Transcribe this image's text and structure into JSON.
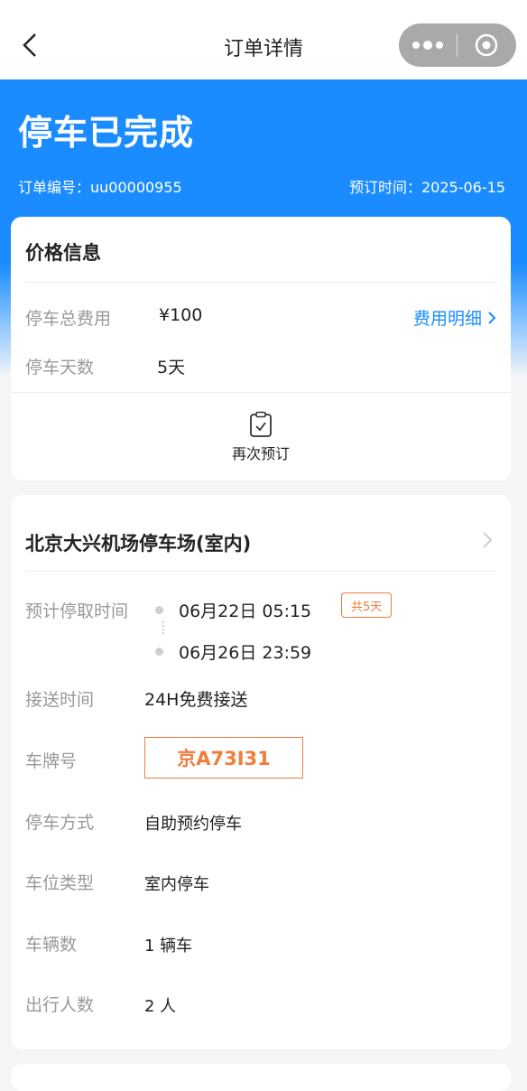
{
  "nav": {
    "title": "订单详情"
  },
  "status": {
    "title": "停车已完成",
    "order_no": "订单编号：uu00000955",
    "order_time": "预订时间：2025-06-15"
  },
  "price": {
    "title": "价格信息",
    "rows": [
      {
        "label": "停车总费用",
        "value": "¥100"
      },
      {
        "label": "停车天数",
        "value": "5天"
      }
    ],
    "detail_link": "费用明细",
    "rebook": "再次预订"
  },
  "lot": {
    "name": "北京大兴机场停车场(室内)",
    "time_label": "预计停取时间",
    "start_time": "06月22日 05:15",
    "end_time": "06月26日 23:59",
    "days_badge": "共5天",
    "shuttle_label": "接送时间",
    "shuttle_value": "24H免费接送",
    "plate_label": "车牌号",
    "plate_value": "京A73I31",
    "mode_label": "停车方式",
    "mode_value": "自助预约停车",
    "spot_label": "车位类型",
    "spot_value": "室内停车",
    "vehicles_label": "车辆数",
    "vehicles_value": "1 辆车",
    "people_label": "出行人数",
    "people_value": "2 人"
  },
  "colors": {
    "primary": "#1b8cff",
    "accent": "#f07d3a"
  }
}
